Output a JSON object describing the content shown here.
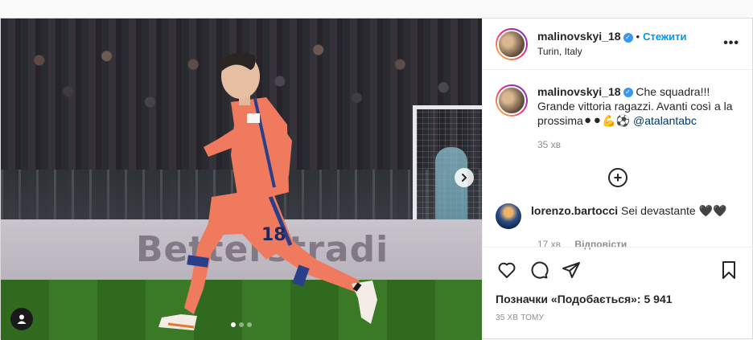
{
  "header": {
    "username": "malinovskyi_18",
    "separator": "•",
    "follow_label": "Стежити",
    "location": "Turin, Italy",
    "more_icon": "more-horizontal-icon"
  },
  "media": {
    "board_text": "Betterstradi",
    "shirt_number": "18",
    "slide_count": 3,
    "active_slide": 1,
    "next_icon": "chevron-right-icon",
    "tag_icon": "user-tag-icon"
  },
  "caption": {
    "username": "malinovskyi_18",
    "text": "Che squadra!!! Grande vittoria ragazzi. Avanti così a la prossima⚫⚫💪⚽",
    "mention": "@atalantabc",
    "time": "35 хв"
  },
  "load_more_icon": "plus-circle-icon",
  "reply": {
    "username": "lorenzo.bartocci",
    "text": "Sei devastante 🖤🖤",
    "time": "17 хв",
    "reply_label": "Відповісти"
  },
  "actions": {
    "like_icon": "heart-icon",
    "comment_icon": "comment-icon",
    "share_icon": "paper-plane-icon",
    "save_icon": "bookmark-icon",
    "likes_label": "Позначки «Подобається»: 5 941",
    "posted_time": "35 ХВ ТОМУ"
  },
  "colors": {
    "accent": "#0095f6",
    "verified": "#3897f0",
    "mention": "#00376b",
    "kit": "#f07a5e"
  }
}
